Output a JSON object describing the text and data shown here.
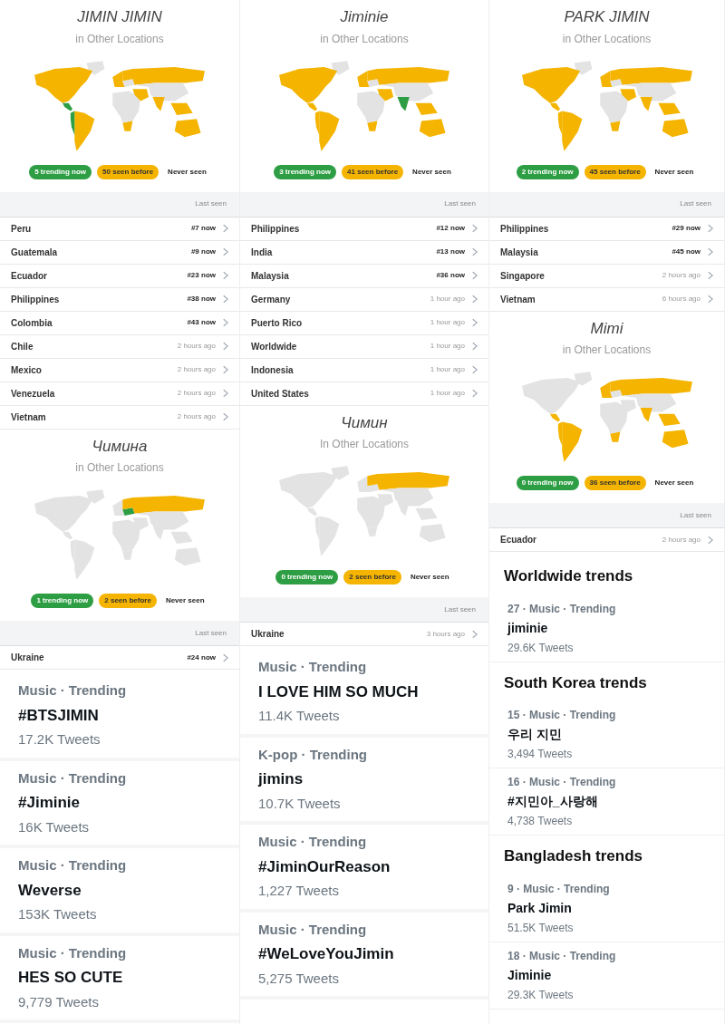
{
  "columns": [
    {
      "sections": [
        {
          "kind": "locations",
          "title": "JIMIN JIMIN",
          "subtitle": "in Other Locations",
          "map": {
            "north_america": {
              "color": "#f4b400"
            },
            "south_america": {
              "color": "#f4b400"
            },
            "andes": {
              "color": "#2e9e44"
            },
            "central_america": {
              "color": "#2e9e44"
            },
            "europe": {
              "color": "#f4b400"
            },
            "russia": {
              "color": "#f4b400"
            },
            "middle_east": {
              "color": "#f4b400"
            },
            "india": {
              "color": "#f4b400"
            },
            "southeast_asia": {
              "color": "#f4b400"
            },
            "southern_africa": {
              "color": "#f4b400"
            },
            "australia": {
              "color": "#f4b400"
            }
          },
          "legend": {
            "trending": "5 trending now",
            "seen": "50 seen before",
            "never": "Never seen"
          },
          "header": "Last seen",
          "rows": [
            {
              "name": "Peru",
              "last_seen": "#7 now",
              "current": true
            },
            {
              "name": "Guatemala",
              "last_seen": "#9 now",
              "current": true
            },
            {
              "name": "Ecuador",
              "last_seen": "#23 now",
              "current": true
            },
            {
              "name": "Philippines",
              "last_seen": "#38 now",
              "current": true
            },
            {
              "name": "Colombia",
              "last_seen": "#43 now",
              "current": true
            },
            {
              "name": "Chile",
              "last_seen": "2 hours ago",
              "current": false
            },
            {
              "name": "Mexico",
              "last_seen": "2 hours ago",
              "current": false
            },
            {
              "name": "Venezuela",
              "last_seen": "2 hours ago",
              "current": false
            },
            {
              "name": "Vietnam",
              "last_seen": "2 hours ago",
              "current": false
            }
          ]
        },
        {
          "kind": "locations",
          "title": "Чимина",
          "subtitle": "in Other Locations",
          "map": {
            "russia": {
              "color": "#f4b400"
            },
            "ukraine": {
              "color": "#2e9e44"
            }
          },
          "legend": {
            "trending": "1 trending now",
            "seen": "2 seen before",
            "never": "Never seen"
          },
          "header": "Last seen",
          "rows": [
            {
              "name": "Ukraine",
              "last_seen": "#24 now",
              "current": true
            }
          ]
        },
        {
          "kind": "trends",
          "groups": [
            {
              "items": [
                {
                  "meta": "Music · Trending",
                  "name": "#BTSJIMIN",
                  "count": "17.2K Tweets"
                },
                {
                  "meta": "Music · Trending",
                  "name": "#Jiminie",
                  "count": "16K Tweets"
                },
                {
                  "meta": "Music · Trending",
                  "name": "Weverse",
                  "count": "153K Tweets"
                },
                {
                  "meta": "Music · Trending",
                  "name": "HES SO CUTE",
                  "count": "9,779 Tweets"
                }
              ]
            }
          ]
        }
      ]
    },
    {
      "sections": [
        {
          "kind": "locations",
          "title": "Jiminie",
          "subtitle": "in Other Locations",
          "map": {
            "north_america": {
              "color": "#f4b400"
            },
            "south_america": {
              "color": "#f4b400"
            },
            "europe": {
              "color": "#f4b400"
            },
            "russia": {
              "color": "#f4b400"
            },
            "middle_east": {
              "color": "#f4b400"
            },
            "india": {
              "color": "#2e9e44"
            },
            "southeast_asia": {
              "color": "#f4b400"
            },
            "southern_africa": {
              "color": "#f4b400"
            },
            "australia": {
              "color": "#f4b400"
            },
            "central_america": {
              "color": "#f4b400"
            },
            "andes": {
              "color": "#f4b400"
            }
          },
          "legend": {
            "trending": "3 trending now",
            "seen": "41 seen before",
            "never": "Never seen"
          },
          "header": "Last seen",
          "rows": [
            {
              "name": "Philippines",
              "last_seen": "#12 now",
              "current": true
            },
            {
              "name": "India",
              "last_seen": "#13 now",
              "current": true
            },
            {
              "name": "Malaysia",
              "last_seen": "#36 now",
              "current": true
            },
            {
              "name": "Germany",
              "last_seen": "1 hour ago",
              "current": false
            },
            {
              "name": "Puerto Rico",
              "last_seen": "1 hour ago",
              "current": false
            },
            {
              "name": "Worldwide",
              "last_seen": "1 hour ago",
              "current": false
            },
            {
              "name": "Indonesia",
              "last_seen": "1 hour ago",
              "current": false
            },
            {
              "name": "United States",
              "last_seen": "1 hour ago",
              "current": false
            }
          ]
        },
        {
          "kind": "locations",
          "title": "Чимин",
          "subtitle": "In Other Locations",
          "map": {
            "russia": {
              "color": "#f4b400"
            }
          },
          "legend": {
            "trending": "0 trending now",
            "seen": "2 seen before",
            "never": "Never seen"
          },
          "header": "Last seen",
          "rows": [
            {
              "name": "Ukraine",
              "last_seen": "3 hours ago",
              "current": false
            }
          ]
        },
        {
          "kind": "trends",
          "groups": [
            {
              "items": [
                {
                  "meta": "Music · Trending",
                  "name": "I LOVE HIM SO MUCH",
                  "count": "11.4K Tweets"
                },
                {
                  "meta": "K-pop · Trending",
                  "name": "jimins",
                  "count": "10.7K Tweets"
                },
                {
                  "meta": "Music · Trending",
                  "name": "#JiminOurReason",
                  "count": "1,227 Tweets"
                },
                {
                  "meta": "Music · Trending",
                  "name": "#WeLoveYouJimin",
                  "count": "5,275 Tweets"
                }
              ]
            }
          ]
        }
      ]
    },
    {
      "sections": [
        {
          "kind": "locations",
          "title": "PARK JIMIN",
          "subtitle": "in Other Locations",
          "map": {
            "north_america": {
              "color": "#f4b400"
            },
            "south_america": {
              "color": "#f4b400"
            },
            "central_america": {
              "color": "#f4b400"
            },
            "andes": {
              "color": "#f4b400"
            },
            "europe": {
              "color": "#f4b400"
            },
            "russia": {
              "color": "#f4b400"
            },
            "middle_east": {
              "color": "#f4b400"
            },
            "india": {
              "color": "#f4b400"
            },
            "southeast_asia": {
              "color": "#f4b400"
            },
            "southern_africa": {
              "color": "#f4b400"
            },
            "australia": {
              "color": "#f4b400"
            }
          },
          "legend": {
            "trending": "2 trending now",
            "seen": "45 seen before",
            "never": "Never seen"
          },
          "header": "Last seen",
          "rows": [
            {
              "name": "Philippines",
              "last_seen": "#29 now",
              "current": true
            },
            {
              "name": "Malaysia",
              "last_seen": "#45 now",
              "current": true
            },
            {
              "name": "Singapore",
              "last_seen": "2 hours ago",
              "current": false
            },
            {
              "name": "Vietnam",
              "last_seen": "6 hours ago",
              "current": false
            }
          ]
        },
        {
          "kind": "locations",
          "title": "Mimi",
          "subtitle": "in Other Locations",
          "map": {
            "south_america": {
              "color": "#f4b400"
            },
            "central_america": {
              "color": "#f4b400"
            },
            "andes": {
              "color": "#f4b400"
            },
            "europe": {
              "color": "#f4b400"
            },
            "russia": {
              "color": "#f4b400"
            },
            "india": {
              "color": "#f4b400"
            },
            "southeast_asia": {
              "color": "#f4b400"
            },
            "southern_africa": {
              "color": "#f4b400"
            },
            "australia": {
              "color": "#f4b400"
            }
          },
          "legend": {
            "trending": "0 trending now",
            "seen": "36 seen before",
            "never": "Never seen"
          },
          "header": "Last seen",
          "rows": [
            {
              "name": "Ecuador",
              "last_seen": "2 hours ago",
              "current": false
            }
          ]
        },
        {
          "kind": "trends",
          "groups": [
            {
              "heading": "Worldwide trends",
              "items": [
                {
                  "meta": "27 · Music · Trending",
                  "name": "jiminie",
                  "count": "29.6K Tweets"
                }
              ]
            },
            {
              "heading": "South Korea trends",
              "items": [
                {
                  "meta": "15 · Music · Trending",
                  "name": "우리 지민",
                  "count": "3,494 Tweets"
                },
                {
                  "meta": "16 · Music · Trending",
                  "name": "#지민아_사랑해",
                  "count": "4,738 Tweets"
                }
              ]
            },
            {
              "heading": "Bangladesh trends",
              "items": [
                {
                  "meta": "9 · Music · Trending",
                  "name": "Park Jimin",
                  "count": "51.5K Tweets"
                },
                {
                  "meta": "18 · Music · Trending",
                  "name": "Jiminie",
                  "count": "29.3K Tweets"
                }
              ]
            }
          ]
        }
      ]
    }
  ]
}
